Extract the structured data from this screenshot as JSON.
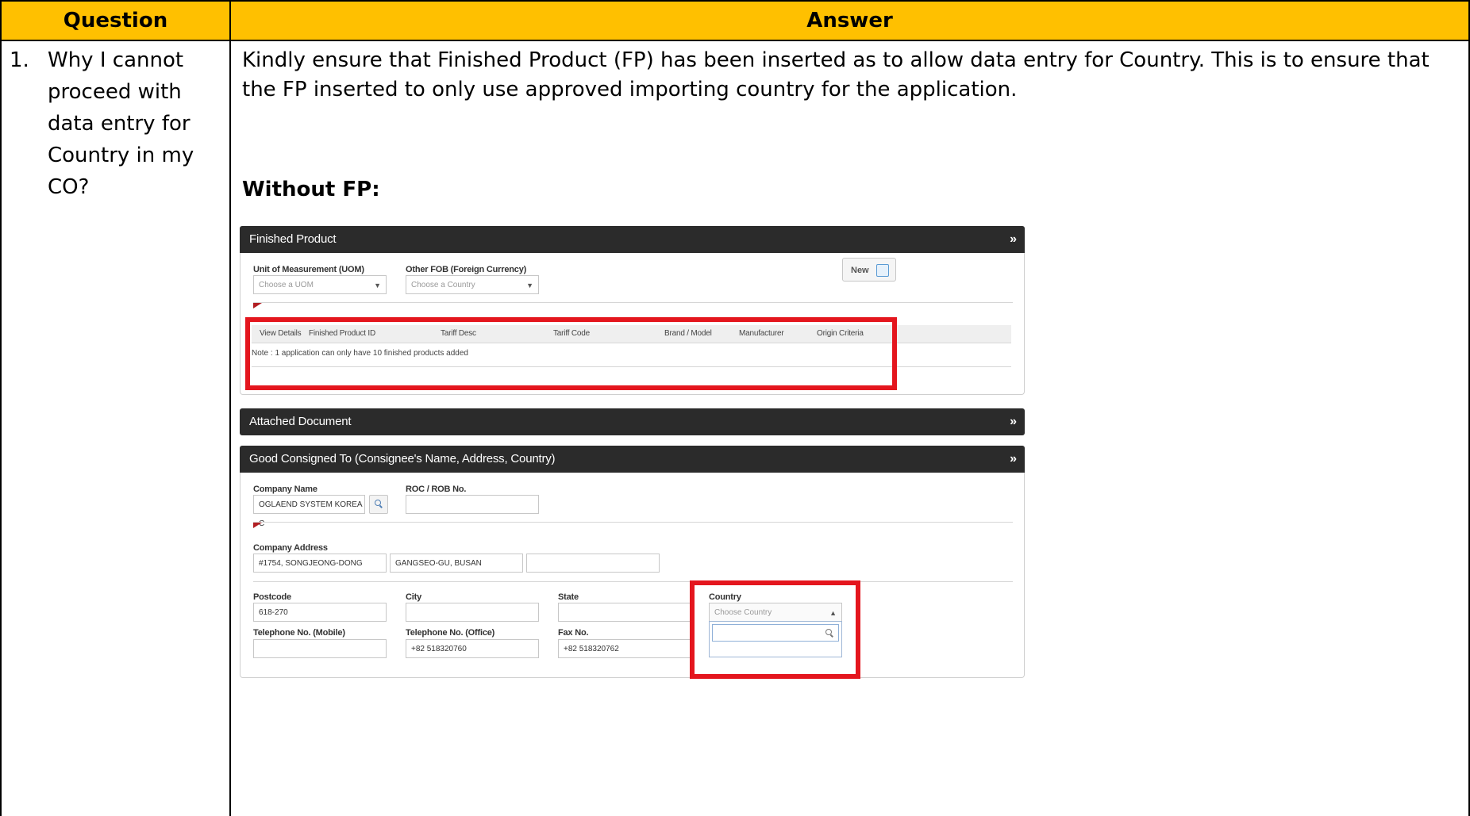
{
  "table": {
    "header_question": "Question",
    "header_answer": "Answer"
  },
  "row1": {
    "number": "1.",
    "question": "Why I cannot proceed with data entry for Country in my CO?",
    "answer": "Kindly ensure that Finished Product (FP) has been inserted as to allow data entry for Country. This is to ensure that the FP inserted to only use approved importing country for the application.",
    "subheading": "Without FP:"
  },
  "screenshot": {
    "finished_product": {
      "title": "Finished Product",
      "uom_label": "Unit of Measurement (UOM)",
      "uom_placeholder": "Choose a UOM",
      "fob_label": "Other FOB (Foreign Currency)",
      "fob_placeholder": "Choose a Country",
      "new_button": "New",
      "columns": [
        "View Details",
        "Finished Product ID",
        "Tariff Desc",
        "Tariff Code",
        "Brand / Model",
        "Manufacturer",
        "Origin Criteria"
      ],
      "note": "Note : 1 application can only have 10 finished products added"
    },
    "attached_document": {
      "title": "Attached Document"
    },
    "consignee": {
      "title": "Good Consigned To (Consignee's Name, Address, Country)",
      "company_name_label": "Company Name",
      "company_name_value": "OGLAEND SYSTEM KOREA C",
      "roc_label": "ROC / ROB No.",
      "roc_value": "",
      "address_label": "Company Address",
      "address_line1": "#1754, SONGJEONG-DONG",
      "address_line2": "GANGSEO-GU, BUSAN",
      "address_line3": "",
      "postcode_label": "Postcode",
      "postcode_value": "618-270",
      "city_label": "City",
      "city_value": "",
      "state_label": "State",
      "state_value": "",
      "country_label": "Country",
      "country_placeholder": "Choose Country",
      "mobile_label": "Telephone No. (Mobile)",
      "mobile_value": "",
      "office_label": "Telephone No. (Office)",
      "office_value": "+82 518320760",
      "fax_label": "Fax No.",
      "fax_value": "+82 518320762"
    },
    "highlight_color": "#e4161e",
    "header_bg": "#2b2b2b",
    "table_header_bg": "#ffc000"
  }
}
